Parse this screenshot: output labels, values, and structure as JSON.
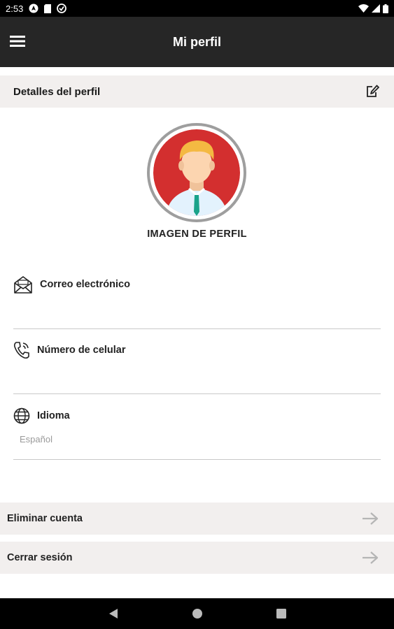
{
  "status_bar": {
    "time": "2:53",
    "icons_left": [
      "android-auto-icon",
      "sd-card-icon",
      "vpn-icon"
    ],
    "icons_right": [
      "wifi-icon",
      "signal-icon",
      "battery-icon"
    ]
  },
  "app_bar": {
    "title": "Mi perfil",
    "menu_icon": "hamburger-menu-icon"
  },
  "profile_section": {
    "title": "Detalles del perfil",
    "edit_icon": "edit-icon"
  },
  "avatar": {
    "label": "IMAGEN DE PERFIL",
    "colors": {
      "background": "#d32f2f",
      "ring": "#9e9e9e",
      "skin": "#fcd5b0",
      "hair": "#f4b942",
      "shirt": "#e3f2fd",
      "tie": "#1aa38a"
    }
  },
  "fields": [
    {
      "icon": "email-icon",
      "label": "Correo electrónico",
      "value": ""
    },
    {
      "icon": "phone-icon",
      "label": "Número de celular",
      "value": ""
    },
    {
      "icon": "globe-icon",
      "label": "Idioma",
      "value": "Español"
    }
  ],
  "actions": [
    {
      "label": "Eliminar cuenta",
      "icon": "arrow-right-icon"
    },
    {
      "label": "Cerrar sesión",
      "icon": "arrow-right-icon"
    }
  ],
  "nav_bar": {
    "buttons": [
      "back-icon",
      "home-icon",
      "recents-icon"
    ]
  }
}
